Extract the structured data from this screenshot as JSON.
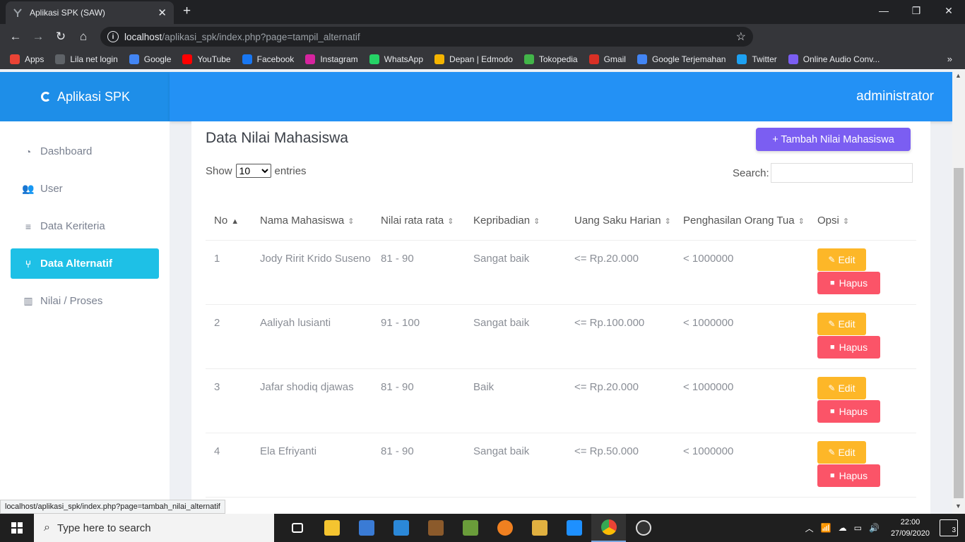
{
  "browser": {
    "tab_title": "Aplikasi SPK (SAW)",
    "url_host": "localhost",
    "url_path": "/aplikasi_spk/index.php?page=tampil_alternatif",
    "status_url": "localhost/aplikasi_spk/index.php?page=tambah_nilai_alternatif",
    "bookmarks": [
      {
        "label": "Apps",
        "icon": "apps-grid-icon",
        "color": "#ea4335"
      },
      {
        "label": "Lila net login",
        "icon": "globe-icon",
        "color": "#5f6368"
      },
      {
        "label": "Google",
        "icon": "google-icon",
        "color": "#4285f4"
      },
      {
        "label": "YouTube",
        "icon": "youtube-icon",
        "color": "#ff0000"
      },
      {
        "label": "Facebook",
        "icon": "facebook-icon",
        "color": "#1877f2"
      },
      {
        "label": "Instagram",
        "icon": "instagram-icon",
        "color": "#d6249f"
      },
      {
        "label": "WhatsApp",
        "icon": "whatsapp-icon",
        "color": "#25d366"
      },
      {
        "label": "Depan | Edmodo",
        "icon": "edmodo-icon",
        "color": "#f4b400"
      },
      {
        "label": "Tokopedia",
        "icon": "tokopedia-icon",
        "color": "#42b549"
      },
      {
        "label": "Gmail",
        "icon": "gmail-icon",
        "color": "#d93025"
      },
      {
        "label": "Google Terjemahan",
        "icon": "translate-icon",
        "color": "#4285f4"
      },
      {
        "label": "Twitter",
        "icon": "twitter-icon",
        "color": "#1da1f2"
      },
      {
        "label": "Online Audio Conv...",
        "icon": "audio-converter-icon",
        "color": "#7b5ef2"
      }
    ]
  },
  "app": {
    "brand": "Aplikasi SPK",
    "user": "administrator",
    "accent": "#2391f5",
    "sidebar": [
      {
        "label": "Dashboard",
        "icon": "dashboard-icon",
        "glyph": "◔",
        "active": false
      },
      {
        "label": "User",
        "icon": "users-icon",
        "glyph": "👥",
        "active": false
      },
      {
        "label": "Data Keriteria",
        "icon": "list-check-icon",
        "glyph": "≡",
        "active": false
      },
      {
        "label": "Data Alternatif",
        "icon": "branch-icon",
        "glyph": "⑂",
        "active": true
      },
      {
        "label": "Nilai / Proses",
        "icon": "bar-chart-icon",
        "glyph": "▥",
        "active": false
      }
    ]
  },
  "content": {
    "title": "Data Nilai Mahasiswa",
    "add_button": "+ Tambah Nilai Mahasiswa",
    "show_label": "Show",
    "entries_label": "entries",
    "page_size": "10",
    "search_label": "Search:",
    "columns": [
      "No",
      "Nama Mahasiswa",
      "Nilai rata rata",
      "Kepribadian",
      "Uang Saku Harian",
      "Penghasilan Orang Tua",
      "Opsi"
    ],
    "rows": [
      {
        "no": "1",
        "nama": "Jody Ririt Krido Suseno",
        "nilai": "81 - 90",
        "kepribadian": "Sangat baik",
        "uang_saku": "<= Rp.20.000",
        "penghasilan": "< 1000000"
      },
      {
        "no": "2",
        "nama": "Aaliyah lusianti",
        "nilai": "91 - 100",
        "kepribadian": "Sangat baik",
        "uang_saku": "<= Rp.100.000",
        "penghasilan": "< 1000000"
      },
      {
        "no": "3",
        "nama": "Jafar shodiq djawas",
        "nilai": "81 - 90",
        "kepribadian": "Baik",
        "uang_saku": "<= Rp.20.000",
        "penghasilan": "< 1000000"
      },
      {
        "no": "4",
        "nama": "Ela Efriyanti",
        "nilai": "81 - 90",
        "kepribadian": "Sangat baik",
        "uang_saku": "<= Rp.50.000",
        "penghasilan": "< 1000000"
      }
    ],
    "edit_label": "Edit",
    "delete_label": "Hapus"
  },
  "taskbar": {
    "search_placeholder": "Type here to search",
    "time": "22:00",
    "date": "27/09/2020",
    "notifications": "3"
  }
}
